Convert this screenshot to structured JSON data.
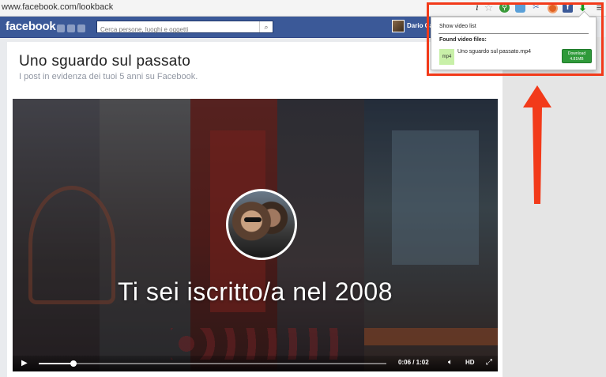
{
  "browser": {
    "url": "www.facebook.com/lookback"
  },
  "toolbar": {
    "icons": [
      "info-icon",
      "star-icon",
      "extension-green-icon",
      "extension-blue-icon",
      "extension-tools-icon",
      "extension-orange-icon",
      "facebook-extension-icon",
      "download-arrow-icon",
      "menu-icon"
    ],
    "download_color": "#1a9a1a"
  },
  "fb": {
    "logo": "facebook",
    "search_placeholder": "Cerca persone, luoghi e oggetti",
    "username": "Dario Ca"
  },
  "page": {
    "title": "Uno sguardo sul passato",
    "subtitle": "I post in evidenza dei tuoi 5 anni su Facebook."
  },
  "video": {
    "overlay_text": "Ti sei iscritto/a nel 2008",
    "time": "0:06 / 1:02",
    "hd_label": "HD",
    "progress": 0.1
  },
  "popup": {
    "show_list": "Show video list",
    "found_title": "Found video files:",
    "file_type": "mp4",
    "file_name": "Uno sguardo sul passato.mp4",
    "download_label": "Download",
    "download_size": "4.81MB",
    "button_color": "#2f9a3a"
  },
  "annotation": {
    "color": "#f23a1a"
  }
}
